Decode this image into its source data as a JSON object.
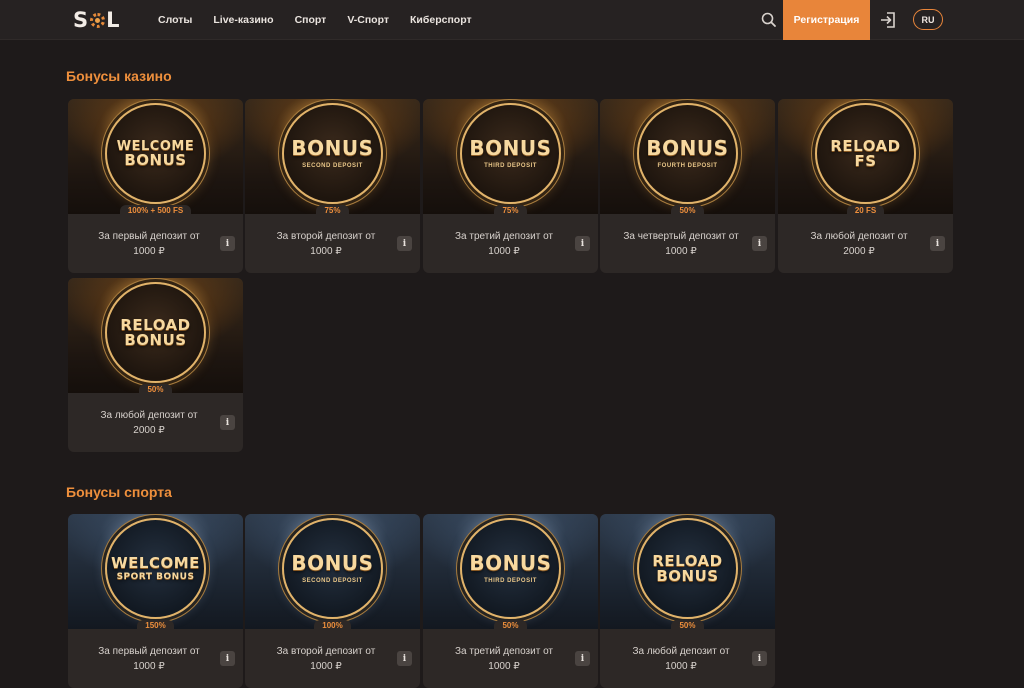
{
  "header": {
    "logo": {
      "before": "S",
      "after": "L"
    },
    "nav": [
      "Слоты",
      "Live-казино",
      "Спорт",
      "V-Спорт",
      "Киберспорт"
    ],
    "register_label": "Регистрация",
    "lang": "RU"
  },
  "casino": {
    "title": "Бонусы казино",
    "cards": [
      {
        "line1": "WELCOME",
        "line2": "BONUS",
        "sub": "",
        "badge": "100% + 500 FS",
        "desc": "За первый депозит от 1000 ₽"
      },
      {
        "line1": "",
        "line2": "BONUS",
        "sub": "SECOND DEPOSIT",
        "badge": "75%",
        "desc": "За второй депозит от 1000 ₽"
      },
      {
        "line1": "",
        "line2": "BONUS",
        "sub": "THIRD DEPOSIT",
        "badge": "75%",
        "desc": "За третий депозит от 1000 ₽"
      },
      {
        "line1": "",
        "line2": "BONUS",
        "sub": "FOURTH DEPOSIT",
        "badge": "50%",
        "desc": "За четвертый депозит от 1000 ₽"
      },
      {
        "line1": "",
        "line2": "RELOAD FS",
        "sub": "",
        "badge": "20 FS",
        "desc": "За любой депозит от 2000 ₽"
      },
      {
        "line1": "RELOAD",
        "line2": "BONUS",
        "sub": "",
        "badge": "50%",
        "desc": "За любой депозит от 2000 ₽"
      }
    ]
  },
  "sport": {
    "title": "Бонусы спорта",
    "cards": [
      {
        "line1": "WELCOME",
        "line2": "SPORT BONUS",
        "sub": "",
        "badge": "150%",
        "desc": "За первый депозит от 1000 ₽"
      },
      {
        "line1": "",
        "line2": "BONUS",
        "sub": "SECOND DEPOSIT",
        "badge": "100%",
        "desc": "За второй депозит от 1000 ₽"
      },
      {
        "line1": "",
        "line2": "BONUS",
        "sub": "THIRD DEPOSIT",
        "badge": "50%",
        "desc": "За третий депозит от 1000 ₽"
      },
      {
        "line1": "RELOAD",
        "line2": "BONUS",
        "sub": "",
        "badge": "50%",
        "desc": "За любой депозит от 1000 ₽"
      }
    ]
  },
  "colors": {
    "accent": "#e8853a",
    "background": "#1e1a1a",
    "card": "#2d2826"
  },
  "icons": {
    "search": "search-icon",
    "login": "login-icon",
    "info": "info-icon"
  }
}
